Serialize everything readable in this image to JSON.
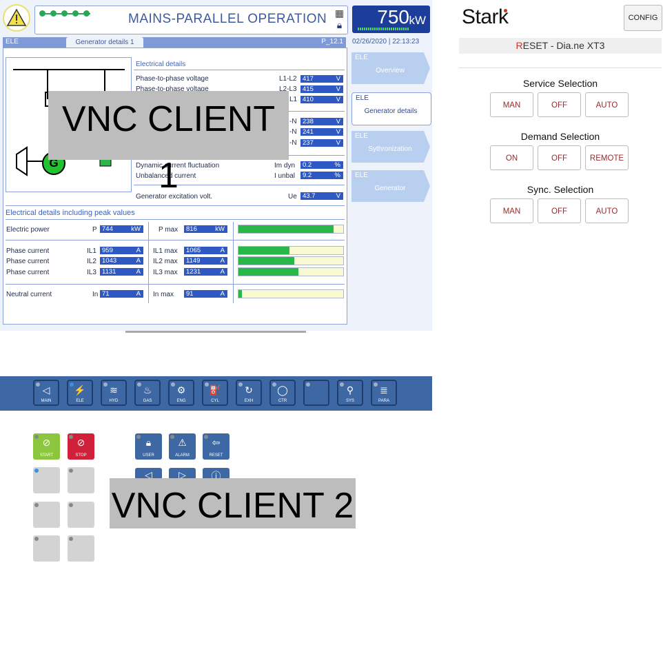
{
  "hmi": {
    "mode_title": "MAINS-PARALLEL OPERATION",
    "power_value": "750",
    "power_unit": "kW",
    "tab_left": "ELE",
    "tab_active": "Generator details 1",
    "tab_right": "P_12.1",
    "date": "02/26/2020",
    "time": "22:13:23",
    "schematic_gen": "G",
    "electrical_details": {
      "title": "Electrical details",
      "rows": [
        {
          "label": "Phase-to-phase voltage",
          "code": "L1-L2",
          "value": "417",
          "unit": "V"
        },
        {
          "label": "Phase-to-phase voltage",
          "code": "L2-L3",
          "value": "415",
          "unit": "V"
        },
        {
          "label": "",
          "code": "L1",
          "value": "410",
          "unit": "V"
        },
        {
          "label": "",
          "code": "-N",
          "value": "238",
          "unit": "V"
        },
        {
          "label": "",
          "code": "-N",
          "value": "241",
          "unit": "V"
        },
        {
          "label": "",
          "code": "-N",
          "value": "237",
          "unit": "V"
        },
        {
          "label": "Dynamic current fluctuation",
          "code": "Im dyn",
          "value": "0.2",
          "unit": "%"
        },
        {
          "label": "Unbalanced current",
          "code": "I unbal",
          "value": "9.2",
          "unit": "%"
        },
        {
          "label": "Generator excitation volt.",
          "code": "Ue",
          "value": "43.7",
          "unit": "V"
        }
      ]
    },
    "peak": {
      "title": "Electrical details including peak values",
      "rows": [
        {
          "label": "Electric power",
          "code": "P",
          "value": "744",
          "unit": "kW",
          "max_code": "P max",
          "max_value": "816",
          "max_unit": "kW",
          "fill": 0.91
        },
        {
          "label": "Phase current",
          "code": "IL1",
          "value": "959",
          "unit": "A",
          "max_code": "IL1 max",
          "max_value": "1065",
          "max_unit": "A",
          "fill": 0.49
        },
        {
          "label": "Phase current",
          "code": "IL2",
          "value": "1043",
          "unit": "A",
          "max_code": "IL2 max",
          "max_value": "1149",
          "max_unit": "A",
          "fill": 0.53
        },
        {
          "label": "Phase current",
          "code": "IL3",
          "value": "1131",
          "unit": "A",
          "max_code": "IL3 max",
          "max_value": "1231",
          "max_unit": "A",
          "fill": 0.57
        },
        {
          "label": "Neutral current",
          "code": "In",
          "value": "71",
          "unit": "A",
          "max_code": "In max",
          "max_value": "91",
          "max_unit": "A",
          "fill": 0.03
        }
      ]
    },
    "side": [
      {
        "cat": "ELE",
        "label": "Overview"
      },
      {
        "cat": "ELE",
        "label": "Generator details"
      },
      {
        "cat": "ELE",
        "label": "Sythronization"
      },
      {
        "cat": "ELE",
        "label": "Generator"
      }
    ]
  },
  "overlays": {
    "client1": "VNC CLIENT 1",
    "client2": "VNC CLIENT 2"
  },
  "toolbar": [
    {
      "glyph": "◁",
      "label": "MAIN"
    },
    {
      "glyph": "⚡",
      "label": "ELE"
    },
    {
      "glyph": "≋",
      "label": "HYD"
    },
    {
      "glyph": "♨",
      "label": "GAS"
    },
    {
      "glyph": "⚙",
      "label": "ENG"
    },
    {
      "glyph": "⛽",
      "label": "CYL"
    },
    {
      "glyph": "↻",
      "label": "EXH"
    },
    {
      "glyph": "◯",
      "label": "CTR"
    },
    {
      "glyph": "",
      "label": ""
    },
    {
      "glyph": "⚲",
      "label": "SYS"
    },
    {
      "glyph": "≣",
      "label": "PARA"
    }
  ],
  "keypad": {
    "start": "START",
    "stop": "STOP",
    "user": "USER",
    "alarm": "ALARM",
    "reset": "RESET"
  },
  "right": {
    "logo": "Stark",
    "config": "CONFIG",
    "device_first": "R",
    "device_rest": "ESET - Dia.ne XT3",
    "groups": [
      {
        "title": "Service Selection",
        "buttons": [
          "MAN",
          "OFF",
          "AUTO"
        ]
      },
      {
        "title": "Demand Selection",
        "buttons": [
          "ON",
          "OFF",
          "REMOTE"
        ]
      },
      {
        "title": "Sync. Selection",
        "buttons": [
          "MAN",
          "OFF",
          "AUTO"
        ]
      }
    ]
  },
  "colors": {
    "accent_blue": "#2e59c5",
    "bar_green": "#28b84a",
    "btn_text": "#9c2a2a",
    "start_green": "#8cc63f",
    "stop_red": "#d0213a"
  }
}
